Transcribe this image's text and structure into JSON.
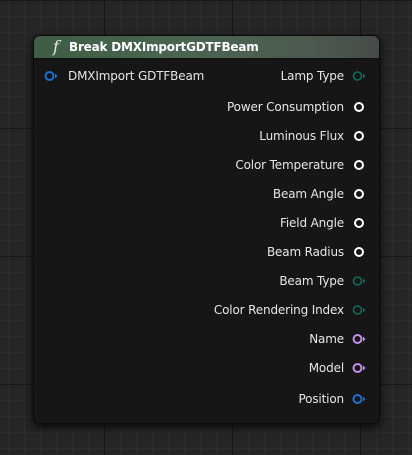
{
  "node": {
    "title": "Break DMXImportGDTFBeam",
    "func_symbol": "f",
    "input_pin": {
      "label": "DMXImport GDTFBeam",
      "color": "#1c6fd6",
      "kind": "struct"
    },
    "output_pins": [
      {
        "label": "Lamp Type",
        "color": "#0a6e5c",
        "kind": "byte"
      },
      {
        "label": "Power Consumption",
        "color": "#ffffff",
        "kind": "float"
      },
      {
        "label": "Luminous Flux",
        "color": "#ffffff",
        "kind": "float"
      },
      {
        "label": "Color Temperature",
        "color": "#ffffff",
        "kind": "float"
      },
      {
        "label": "Beam Angle",
        "color": "#ffffff",
        "kind": "float"
      },
      {
        "label": "Field Angle",
        "color": "#ffffff",
        "kind": "float"
      },
      {
        "label": "Beam Radius",
        "color": "#ffffff",
        "kind": "float"
      },
      {
        "label": "Beam Type",
        "color": "#0a6e5c",
        "kind": "byte"
      },
      {
        "label": "Color Rendering Index",
        "color": "#0a6e5c",
        "kind": "byte"
      },
      {
        "label": "Name",
        "color": "#c98ef2",
        "kind": "name"
      },
      {
        "label": "Model",
        "color": "#c98ef2",
        "kind": "name"
      },
      {
        "label": "Position",
        "color": "#1c6fd6",
        "kind": "struct"
      }
    ]
  },
  "colors": {
    "header_start": "#3f5e45",
    "node_body": "#161616",
    "canvas": "#262626"
  }
}
